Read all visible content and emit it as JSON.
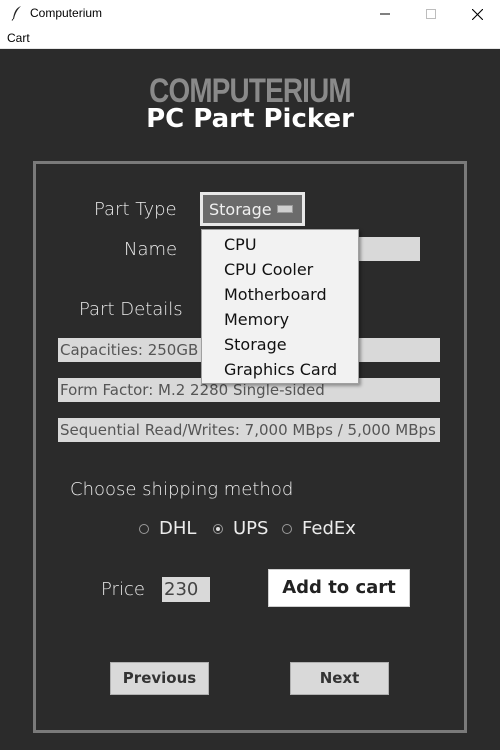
{
  "window": {
    "title": "Computerium",
    "icon": "feather-icon",
    "controls": [
      "minimize-icon",
      "maximize-icon",
      "close-icon"
    ]
  },
  "menubar": {
    "items": [
      {
        "label": "Cart"
      }
    ]
  },
  "header": {
    "logo": "COMPUTERIUM",
    "subtitle": "PC Part Picker"
  },
  "form": {
    "part_type_label": "Part Type",
    "part_type_value": "Storage",
    "name_label": "Name",
    "name_value": "",
    "details_label": "Part Details",
    "details": [
      "Capacities: 250GB",
      "Form Factor: M.2 2280 Single-sided",
      "Sequential Read/Writes: 7,000 MBps / 5,000 MBps"
    ],
    "dropdown_options": [
      "CPU",
      "CPU Cooler",
      "Motherboard",
      "Memory",
      "Storage",
      "Graphics Card"
    ],
    "shipping_label": "Choose shipping method",
    "shipping_options": [
      {
        "label": "DHL",
        "selected": false
      },
      {
        "label": "UPS",
        "selected": true
      },
      {
        "label": "FedEx",
        "selected": false
      }
    ],
    "price_label": "Price",
    "price_value": "230",
    "add_to_cart_label": "Add to cart"
  },
  "nav": {
    "previous_label": "Previous",
    "next_label": "Next"
  },
  "colors": {
    "background": "#2b2b2b",
    "panel_border": "#7a7a7a",
    "field_bg": "#d9d9d9",
    "logo": "#8a8a8a",
    "text": "#ffffff"
  }
}
